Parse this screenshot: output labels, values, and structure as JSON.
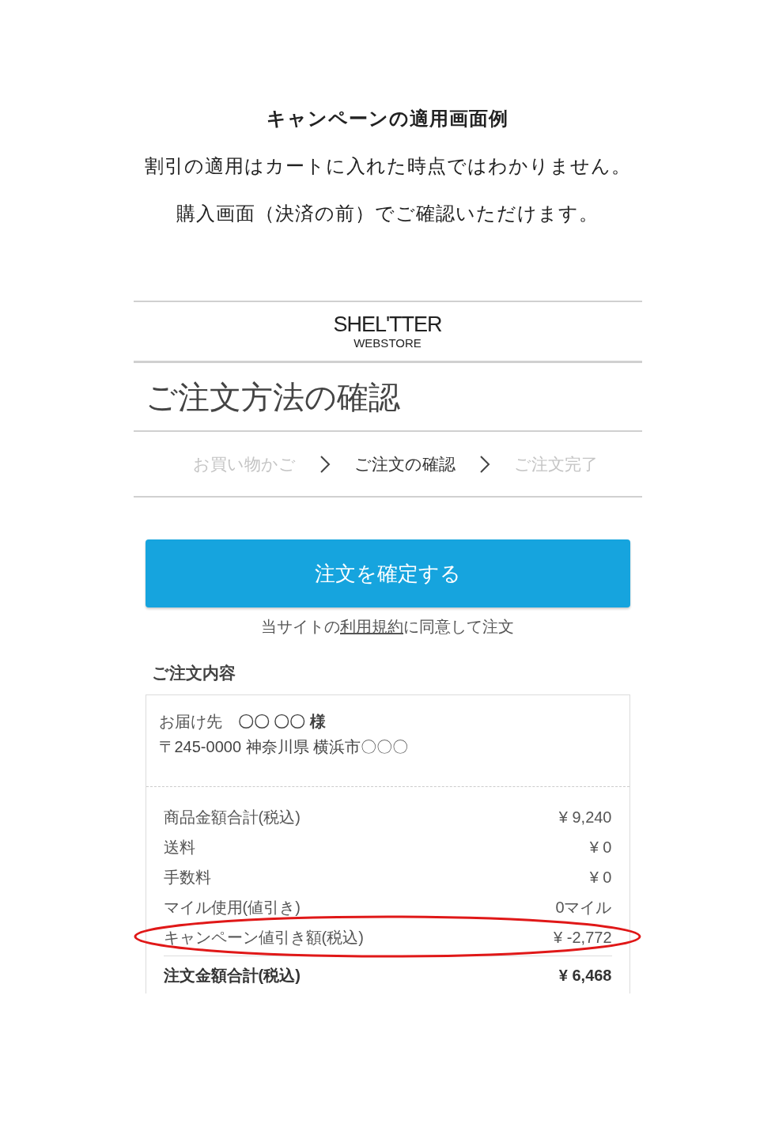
{
  "title": "キャンペーンの適用画面例",
  "intro": [
    "割引の適用はカートに入れた時点ではわかりません。",
    "購入画面（決済の前）でご確認いただけます。"
  ],
  "screenshot": {
    "logo": {
      "name": "SHEL'TTER",
      "sub": "WEBSTORE"
    },
    "heading": "ご注文方法の確認",
    "steps": [
      {
        "label": "お買い物かご",
        "selected": false
      },
      {
        "label": "ご注文の確認",
        "selected": true
      },
      {
        "label": "ご注文完了",
        "selected": false
      }
    ],
    "confirm_button": "注文を確定する",
    "terms": {
      "before": "当サイトの",
      "link": "利用規約",
      "after": "に同意して注文"
    },
    "section_title": "ご注文内容",
    "delivery": {
      "label": "お届け先",
      "recipient": "〇〇 〇〇 様",
      "address": "〒245-0000 神奈川県 横浜市〇〇〇"
    },
    "summary": [
      {
        "kind": "line",
        "label": "商品金額合計(税込)",
        "value": "¥ 9,240",
        "highlighted": false
      },
      {
        "kind": "line",
        "label": "送料",
        "value": "¥ 0",
        "highlighted": false
      },
      {
        "kind": "line",
        "label": "手数料",
        "value": "¥ 0",
        "highlighted": false
      },
      {
        "kind": "line",
        "label": "マイル使用(値引き)",
        "value": "0マイル",
        "highlighted": false
      },
      {
        "kind": "line",
        "label": "キャンペーン値引き額(税込)",
        "value": "¥ -2,772",
        "highlighted": true
      },
      {
        "kind": "total",
        "label": "注文金額合計(税込)",
        "value": "¥ 6,468",
        "highlighted": false
      }
    ]
  }
}
